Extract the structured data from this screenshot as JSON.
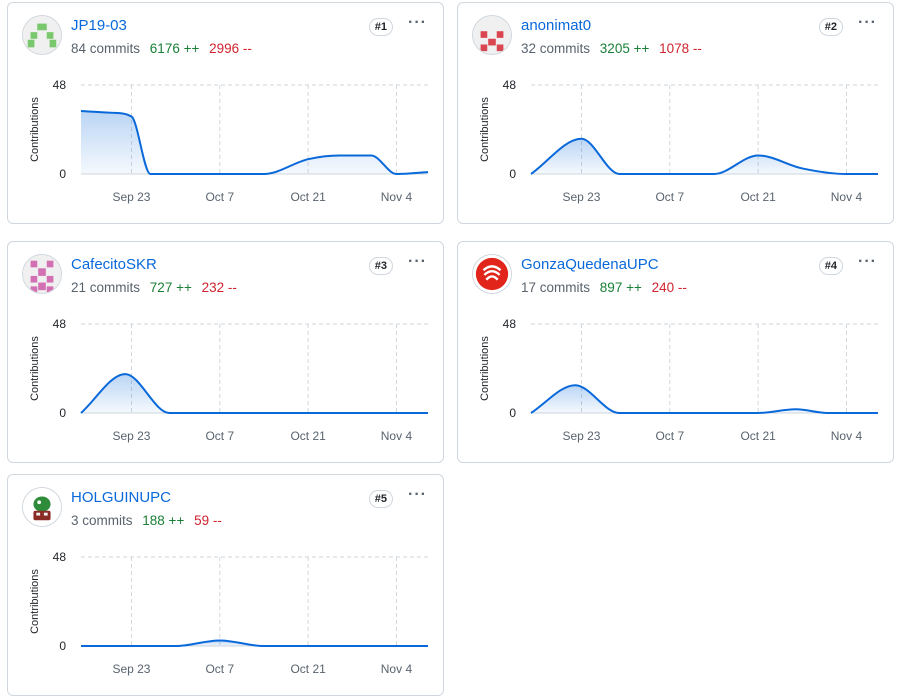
{
  "contributors": [
    {
      "username": "JP19-03",
      "commits": "84 commits",
      "additions": "6176 ++",
      "deletions": "2996 --",
      "rank": "#1",
      "avatar": "identicon-green",
      "chart_data": {
        "type": "area",
        "ylabel": "Contributions",
        "ylim": [
          0,
          48
        ],
        "yticks": [
          "48",
          "0"
        ],
        "x_ticks": [
          "Sep 23",
          "Oct 7",
          "Oct 21",
          "Nov 4"
        ],
        "x": [
          "Sep 15",
          "Sep 20",
          "Sep 23",
          "Sep 26",
          "Oct 1",
          "Oct 7",
          "Oct 14",
          "Oct 21",
          "Oct 26",
          "Oct 31",
          "Nov 4",
          "Nov 9"
        ],
        "values": [
          34,
          33,
          31,
          0,
          0,
          0,
          0,
          8,
          10,
          10,
          0,
          1
        ]
      }
    },
    {
      "username": "anonimat0",
      "commits": "32 commits",
      "additions": "3205 ++",
      "deletions": "1078 --",
      "rank": "#2",
      "avatar": "identicon-red",
      "chart_data": {
        "type": "area",
        "ylabel": "Contributions",
        "ylim": [
          0,
          48
        ],
        "yticks": [
          "48",
          "0"
        ],
        "x_ticks": [
          "Sep 23",
          "Oct 7",
          "Oct 21",
          "Nov 4"
        ],
        "x": [
          "Sep 15",
          "Sep 23",
          "Sep 29",
          "Oct 7",
          "Oct 14",
          "Oct 21",
          "Oct 28",
          "Nov 4",
          "Nov 9"
        ],
        "values": [
          0,
          19,
          0,
          0,
          0,
          10,
          3,
          0,
          0
        ]
      }
    },
    {
      "username": "CafecitoSKR",
      "commits": "21 commits",
      "additions": "727 ++",
      "deletions": "232 --",
      "rank": "#3",
      "avatar": "identicon-pink",
      "chart_data": {
        "type": "area",
        "ylabel": "Contributions",
        "ylim": [
          0,
          48
        ],
        "yticks": [
          "48",
          "0"
        ],
        "x_ticks": [
          "Sep 23",
          "Oct 7",
          "Oct 21",
          "Nov 4"
        ],
        "x": [
          "Sep 15",
          "Sep 22",
          "Sep 29",
          "Oct 7",
          "Oct 21",
          "Nov 4",
          "Nov 9"
        ],
        "values": [
          0,
          21,
          0,
          0,
          0,
          0,
          0
        ]
      }
    },
    {
      "username": "GonzaQuedenaUPC",
      "commits": "17 commits",
      "additions": "897 ++",
      "deletions": "240 --",
      "rank": "#4",
      "avatar": "upc-logo",
      "chart_data": {
        "type": "area",
        "ylabel": "Contributions",
        "ylim": [
          0,
          48
        ],
        "yticks": [
          "48",
          "0"
        ],
        "x_ticks": [
          "Sep 23",
          "Oct 7",
          "Oct 21",
          "Nov 4"
        ],
        "x": [
          "Sep 15",
          "Sep 22",
          "Sep 29",
          "Oct 7",
          "Oct 21",
          "Oct 27",
          "Nov 1",
          "Nov 4",
          "Nov 9"
        ],
        "values": [
          0,
          15,
          0,
          0,
          0,
          2,
          0,
          0,
          0
        ]
      }
    },
    {
      "username": "HOLGUINUPC",
      "commits": "3 commits",
      "additions": "188 ++",
      "deletions": "59 --",
      "rank": "#5",
      "avatar": "character-avatar",
      "chart_data": {
        "type": "area",
        "ylabel": "Contributions",
        "ylim": [
          0,
          48
        ],
        "yticks": [
          "48",
          "0"
        ],
        "x_ticks": [
          "Sep 23",
          "Oct 7",
          "Oct 21",
          "Nov 4"
        ],
        "x": [
          "Sep 15",
          "Sep 23",
          "Sep 30",
          "Oct 7",
          "Oct 14",
          "Oct 21",
          "Nov 4",
          "Nov 9"
        ],
        "values": [
          0,
          0,
          0,
          3,
          0,
          0,
          0,
          0
        ]
      }
    }
  ],
  "colors": {
    "line": "#0969da",
    "fill": "#0969da",
    "link": "#0969da",
    "add": "#1a7f37",
    "del": "#d1242f",
    "grid": "#d0d7de"
  },
  "more_icon": "kebab-horizontal-icon"
}
